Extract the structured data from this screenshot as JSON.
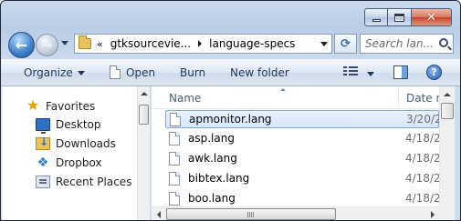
{
  "window": {
    "caption": {
      "minimize": "minimize-icon",
      "maximize": "maximize-icon",
      "close": "✕"
    }
  },
  "nav": {
    "back_glyph": "←",
    "forward_glyph": "→",
    "address": {
      "overflow": "«",
      "crumbs": [
        "gtksourcevie...",
        "language-specs"
      ]
    },
    "refresh_glyph": "⟳",
    "search_placeholder": "Search lan..."
  },
  "commandbar": {
    "organize": "Organize",
    "open": "Open",
    "burn": "Burn",
    "new_folder": "New folder",
    "help": "?"
  },
  "navpane": {
    "favorites": "Favorites",
    "items": [
      "Desktop",
      "Downloads",
      "Dropbox",
      "Recent Places"
    ]
  },
  "filelist": {
    "columns": {
      "name": "Name",
      "date": "Date m"
    },
    "rows": [
      {
        "name": "apmonitor.lang",
        "date": "3/20/2",
        "selected": true
      },
      {
        "name": "asp.lang",
        "date": "4/18/2",
        "selected": false
      },
      {
        "name": "awk.lang",
        "date": "4/18/2",
        "selected": false
      },
      {
        "name": "bibtex.lang",
        "date": "4/18/2",
        "selected": false
      },
      {
        "name": "boo.lang",
        "date": "4/18/2",
        "selected": false
      }
    ]
  },
  "colors": {
    "selection": "#d4e6fa",
    "command_text": "#1e395b",
    "accent": "#2f72c2"
  }
}
